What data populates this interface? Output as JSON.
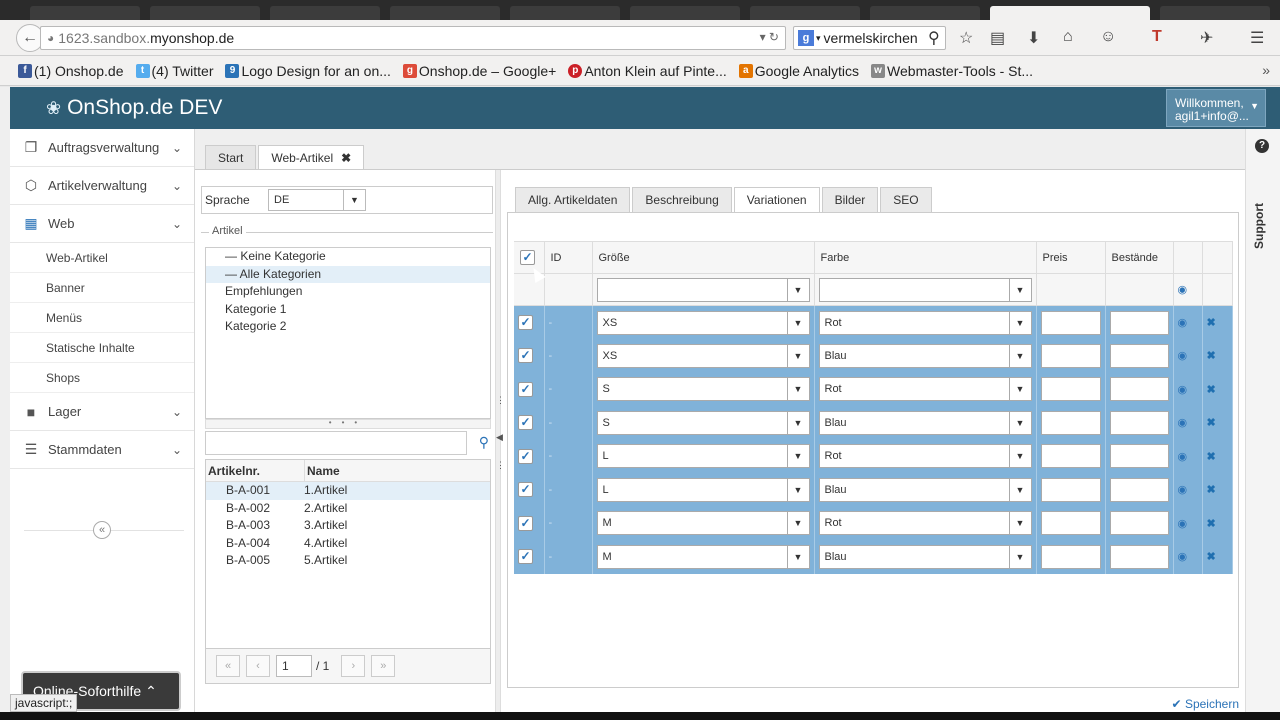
{
  "browser": {
    "url_prefix": "1623.sandbox.",
    "url_host": "myonshop.de",
    "search_text": "vermelskirchen",
    "search_engine_glyph": "g",
    "bookmarks": [
      {
        "label": "(1) Onshop.de",
        "icon": "facebook-icon",
        "color": "#3b5998"
      },
      {
        "label": "(4) Twitter",
        "icon": "twitter-icon",
        "color": "#55acee"
      },
      {
        "label": "Logo Design for an on...",
        "icon": "99designs-icon",
        "color": "#2b73b7"
      },
      {
        "label": "Onshop.de – Google+",
        "icon": "googleplus-icon",
        "color": "#dd4b39"
      },
      {
        "label": "Anton Klein auf Pinte...",
        "icon": "pinterest-icon",
        "color": "#cb2027"
      },
      {
        "label": "Google Analytics",
        "icon": "analytics-icon",
        "color": "#e37400"
      },
      {
        "label": "Webmaster-Tools - St...",
        "icon": "webmaster-icon",
        "color": "#888888"
      }
    ]
  },
  "app": {
    "brand": "OnShop.de DEV",
    "welcome_line1": "Willkommen,",
    "welcome_line2": "agil1+info@..."
  },
  "sidebar": {
    "items": [
      {
        "label": "Auftragsverwaltung",
        "icon": "box-icon"
      },
      {
        "label": "Artikelverwaltung",
        "icon": "cube-icon"
      },
      {
        "label": "Web",
        "icon": "grid-icon"
      }
    ],
    "sub_items": [
      "Web-Artikel",
      "Banner",
      "Menüs",
      "Statische Inhalte",
      "Shops"
    ],
    "items_after": [
      {
        "label": "Lager",
        "icon": "bookmark-icon"
      },
      {
        "label": "Stammdaten",
        "icon": "list-icon"
      }
    ]
  },
  "tabs": {
    "start": "Start",
    "web_artikel": "Web-Artikel"
  },
  "left_panel": {
    "sprache_label": "Sprache",
    "sprache_value": "DE",
    "artikel_legend": "Artikel",
    "categories": [
      "— Keine Kategorie",
      "— Alle Kategorien",
      "Empfehlungen",
      "Kategorie 1",
      "Kategorie 2"
    ],
    "grid_headers": {
      "nr": "Artikelnr.",
      "name": "Name"
    },
    "articles": [
      {
        "nr": "B-A-001",
        "name": "1.Artikel"
      },
      {
        "nr": "B-A-002",
        "name": "2.Artikel"
      },
      {
        "nr": "B-A-003",
        "name": "3.Artikel"
      },
      {
        "nr": "B-A-004",
        "name": "4.Artikel"
      },
      {
        "nr": "B-A-005",
        "name": "5.Artikel"
      }
    ],
    "pager_page": "1",
    "pager_total": "/ 1"
  },
  "right_panel": {
    "tabs": [
      "Allg. Artikeldaten",
      "Beschreibung",
      "Variationen",
      "Bilder",
      "SEO"
    ],
    "headers": {
      "id": "ID",
      "groesse": "Größe",
      "farbe": "Farbe",
      "preis": "Preis",
      "bestaende": "Bestände"
    },
    "rows": [
      {
        "id": "-",
        "groesse": "XS",
        "farbe": "Rot"
      },
      {
        "id": "-",
        "groesse": "XS",
        "farbe": "Blau"
      },
      {
        "id": "-",
        "groesse": "S",
        "farbe": "Rot"
      },
      {
        "id": "-",
        "groesse": "S",
        "farbe": "Blau"
      },
      {
        "id": "-",
        "groesse": "L",
        "farbe": "Rot"
      },
      {
        "id": "-",
        "groesse": "L",
        "farbe": "Blau"
      },
      {
        "id": "-",
        "groesse": "M",
        "farbe": "Rot"
      },
      {
        "id": "-",
        "groesse": "M",
        "farbe": "Blau"
      }
    ],
    "save_label": "Speichern"
  },
  "support_label": "Support",
  "help_label": "Online-Soforthilfe",
  "status_tip": "javascript:;"
}
